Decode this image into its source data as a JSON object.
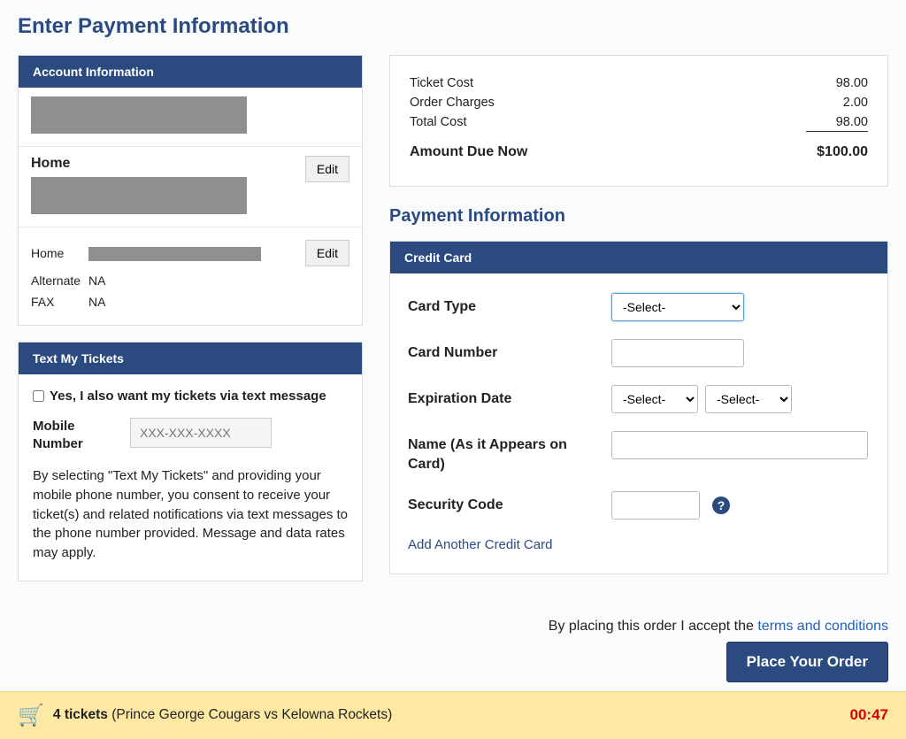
{
  "page": {
    "title": "Enter Payment Information"
  },
  "account": {
    "header": "Account Information",
    "address_label": "Home",
    "edit_label": "Edit",
    "phones": [
      {
        "label": "Home",
        "value": ""
      },
      {
        "label": "Alternate",
        "value": "NA"
      },
      {
        "label": "FAX",
        "value": "NA"
      }
    ]
  },
  "textmytix": {
    "header": "Text My Tickets",
    "optin_label": "Yes, I also want my tickets via text message",
    "mobile_label": "Mobile Number",
    "mobile_placeholder": "XXX-XXX-XXXX",
    "consent": "By selecting \"Text My Tickets\" and providing your mobile phone number, you consent to receive your ticket(s) and related notifications via text messages to the phone number provided. Message and data rates may apply."
  },
  "summary": {
    "ticket_cost_label": "Ticket Cost",
    "ticket_cost_value": "98.00",
    "order_charges_label": "Order Charges",
    "order_charges_value": "2.00",
    "total_cost_label": "Total Cost",
    "total_cost_value": "98.00",
    "amount_due_label": "Amount Due Now",
    "amount_due_value": "$100.00"
  },
  "payment": {
    "section_title": "Payment Information",
    "cc_header": "Credit Card",
    "card_type_label": "Card Type",
    "card_type_placeholder": "-Select-",
    "card_number_label": "Card Number",
    "exp_label": "Expiration Date",
    "exp_month_placeholder": "-Select-",
    "exp_year_placeholder": "-Select-",
    "name_label": "Name (As it Appears on Card)",
    "security_label": "Security Code",
    "add_another": "Add Another Credit Card"
  },
  "terms": {
    "prefix": "By placing this order I accept the ",
    "link": "terms and conditions"
  },
  "buttons": {
    "place_order": "Place Your Order"
  },
  "footer": {
    "ticket_count": "4 tickets",
    "event": "(Prince George Cougars vs Kelowna Rockets)",
    "timer": "00:47"
  }
}
